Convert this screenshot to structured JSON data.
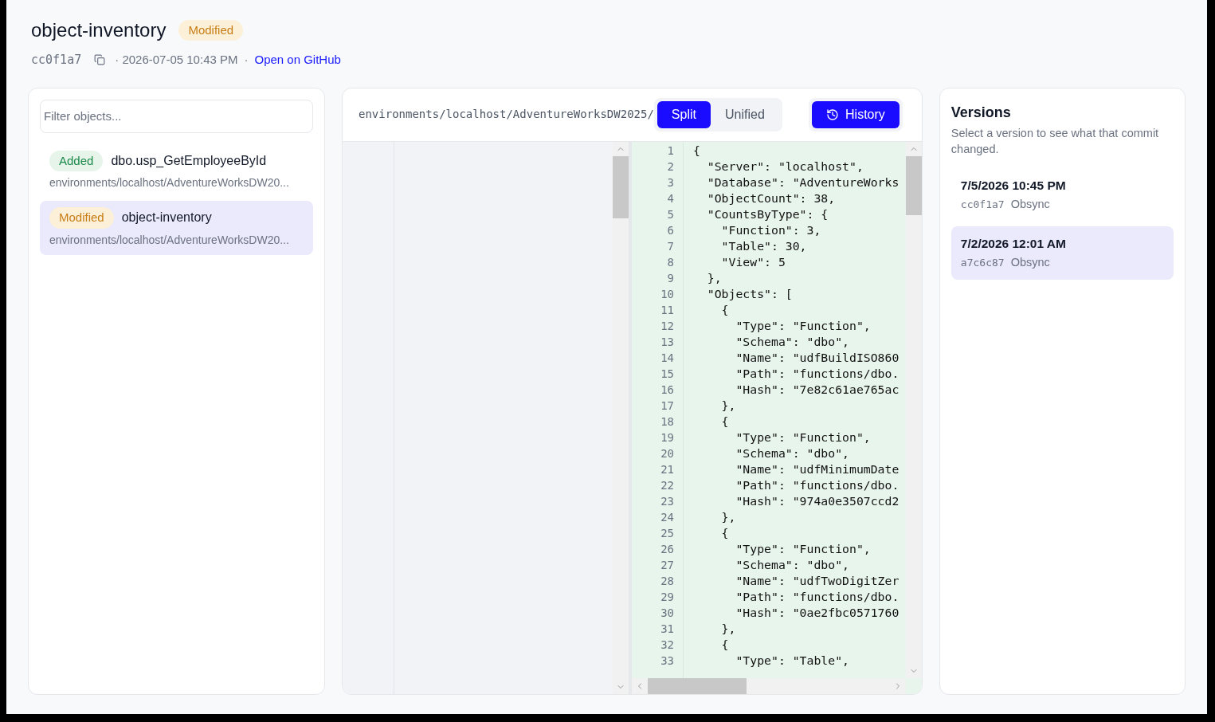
{
  "header": {
    "title": "object-inventory",
    "status": {
      "kind": "modified",
      "label": "Modified"
    },
    "commit": "cc0f1a7",
    "date": "· 2026-07-05 10:43 PM",
    "separator": "·",
    "link": "Open on GitHub"
  },
  "sidebar": {
    "filter": {
      "placeholder": "Filter objects..."
    },
    "items": [
      {
        "status": {
          "kind": "added",
          "label": "Added"
        },
        "name": "dbo.usp_GetEmployeeById",
        "path": "environments/localhost/AdventureWorksDW20...",
        "selected": false
      },
      {
        "status": {
          "kind": "modified",
          "label": "Modified"
        },
        "name": "object-inventory",
        "path": "environments/localhost/AdventureWorksDW20...",
        "selected": true
      }
    ]
  },
  "diff": {
    "path": "environments/localhost/AdventureWorksDW2025/",
    "modes": [
      {
        "label": "Split",
        "selected": true
      },
      {
        "label": "Unified",
        "selected": false
      }
    ],
    "history_button": "History",
    "right_lines": [
      {
        "number": "1",
        "text": "{"
      },
      {
        "number": "2",
        "text": "  \"Server\": \"localhost\","
      },
      {
        "number": "3",
        "text": "  \"Database\": \"AdventureWorks"
      },
      {
        "number": "4",
        "text": "  \"ObjectCount\": 38,"
      },
      {
        "number": "5",
        "text": "  \"CountsByType\": {"
      },
      {
        "number": "6",
        "text": "    \"Function\": 3,"
      },
      {
        "number": "7",
        "text": "    \"Table\": 30,"
      },
      {
        "number": "8",
        "text": "    \"View\": 5"
      },
      {
        "number": "9",
        "text": "  },"
      },
      {
        "number": "10",
        "text": "  \"Objects\": ["
      },
      {
        "number": "11",
        "text": "    {"
      },
      {
        "number": "12",
        "text": "      \"Type\": \"Function\","
      },
      {
        "number": "13",
        "text": "      \"Schema\": \"dbo\","
      },
      {
        "number": "14",
        "text": "      \"Name\": \"udfBuildISO860"
      },
      {
        "number": "15",
        "text": "      \"Path\": \"functions/dbo."
      },
      {
        "number": "16",
        "text": "      \"Hash\": \"7e82c61ae765ac"
      },
      {
        "number": "17",
        "text": "    },"
      },
      {
        "number": "18",
        "text": "    {"
      },
      {
        "number": "19",
        "text": "      \"Type\": \"Function\","
      },
      {
        "number": "20",
        "text": "      \"Schema\": \"dbo\","
      },
      {
        "number": "21",
        "text": "      \"Name\": \"udfMinimumDate"
      },
      {
        "number": "22",
        "text": "      \"Path\": \"functions/dbo."
      },
      {
        "number": "23",
        "text": "      \"Hash\": \"974a0e3507ccd2"
      },
      {
        "number": "24",
        "text": "    },"
      },
      {
        "number": "25",
        "text": "    {"
      },
      {
        "number": "26",
        "text": "      \"Type\": \"Function\","
      },
      {
        "number": "27",
        "text": "      \"Schema\": \"dbo\","
      },
      {
        "number": "28",
        "text": "      \"Name\": \"udfTwoDigitZer"
      },
      {
        "number": "29",
        "text": "      \"Path\": \"functions/dbo."
      },
      {
        "number": "30",
        "text": "      \"Hash\": \"0ae2fbc0571760"
      },
      {
        "number": "31",
        "text": "    },"
      },
      {
        "number": "32",
        "text": "    {"
      },
      {
        "number": "33",
        "text": "      \"Type\": \"Table\","
      }
    ]
  },
  "versions": {
    "title": "Versions",
    "description": "Select a version to see what that commit changed.",
    "items": [
      {
        "date": "7/5/2026 10:45 PM",
        "commit": "cc0f1a7",
        "author": "Obsync",
        "selected": false
      },
      {
        "date": "7/2/2026 12:01 AM",
        "commit": "a7c6c87",
        "author": "Obsync",
        "selected": true
      }
    ]
  }
}
